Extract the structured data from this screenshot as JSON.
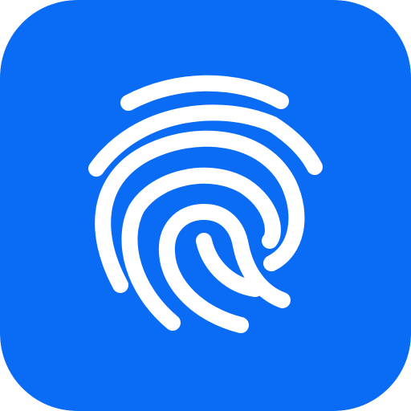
{
  "icon": {
    "name": "fingerprint-icon",
    "background_color": "#0A6CF5",
    "foreground_color": "#FFFFFF"
  }
}
